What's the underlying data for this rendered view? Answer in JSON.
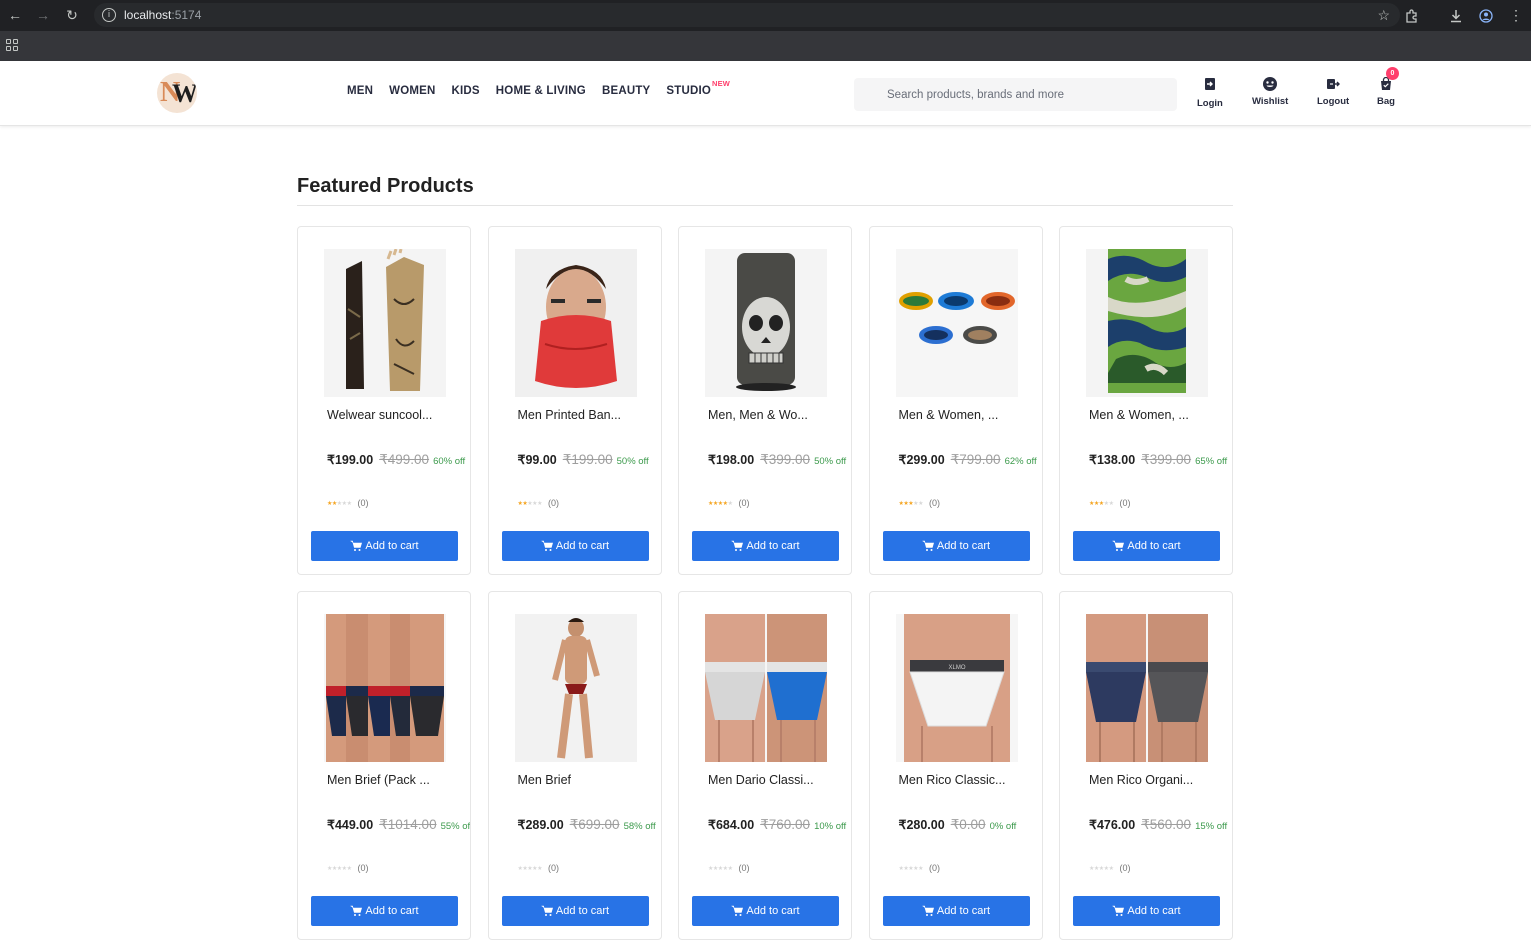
{
  "browser": {
    "url_host": "localhost",
    "url_port": ":5174"
  },
  "header": {
    "logo_alt": "NW",
    "nav": [
      {
        "label": "MEN"
      },
      {
        "label": "WOMEN"
      },
      {
        "label": "KIDS"
      },
      {
        "label": "HOME & LIVING"
      },
      {
        "label": "BEAUTY"
      },
      {
        "label": "STUDIO",
        "badge": "NEW"
      }
    ],
    "search_placeholder": "Search products, brands and more",
    "actions": {
      "login": "Login",
      "wishlist": "Wishlist",
      "logout": "Logout",
      "bag": "Bag",
      "bag_count": "0"
    }
  },
  "main": {
    "title": "Featured Products",
    "add_to_cart_label": "Add to cart",
    "products": [
      {
        "name": "Welwear suncool...",
        "price": "₹199.00",
        "mrp": "₹499.00",
        "discount": "60% off",
        "stars": 2,
        "reviews": "(0)",
        "image": "arm-sleeves"
      },
      {
        "name": "Men Printed Ban...",
        "price": "₹99.00",
        "mrp": "₹199.00",
        "discount": "50% off",
        "stars": 2,
        "reviews": "(0)",
        "image": "red-bandana"
      },
      {
        "name": "Men, Men & Wo...",
        "price": "₹198.00",
        "mrp": "₹399.00",
        "discount": "50% off",
        "stars": 4,
        "reviews": "(0)",
        "image": "skull-neck-gaiter"
      },
      {
        "name": "Men & Women, ...",
        "price": "₹299.00",
        "mrp": "₹799.00",
        "discount": "62% off",
        "stars": 3,
        "reviews": "(0)",
        "image": "headbands"
      },
      {
        "name": "Men & Women, ...",
        "price": "₹138.00",
        "mrp": "₹399.00",
        "discount": "65% off",
        "stars": 3,
        "reviews": "(0)",
        "image": "camo-bandana"
      },
      {
        "name": "Men Brief  (Pack ...",
        "price": "₹449.00",
        "mrp": "₹1014.00",
        "discount": "55% off",
        "stars": 0,
        "reviews": "(0)",
        "image": "briefs-pack"
      },
      {
        "name": "Men Brief",
        "price": "₹289.00",
        "mrp": "₹699.00",
        "discount": "58% off",
        "stars": 0,
        "reviews": "(0)",
        "image": "brief-model"
      },
      {
        "name": "Men Dario Classi...",
        "price": "₹684.00",
        "mrp": "₹760.00",
        "discount": "10% off",
        "stars": 0,
        "reviews": "(0)",
        "image": "briefs-grey-blue"
      },
      {
        "name": "Men Rico Classic...",
        "price": "₹280.00",
        "mrp": "₹0.00",
        "discount": "0% off",
        "stars": 0,
        "reviews": "(0)",
        "image": "brief-white"
      },
      {
        "name": "Men Rico Organi...",
        "price": "₹476.00",
        "mrp": "₹560.00",
        "discount": "15% off",
        "stars": 0,
        "reviews": "(0)",
        "image": "briefs-navy-grey"
      }
    ]
  }
}
